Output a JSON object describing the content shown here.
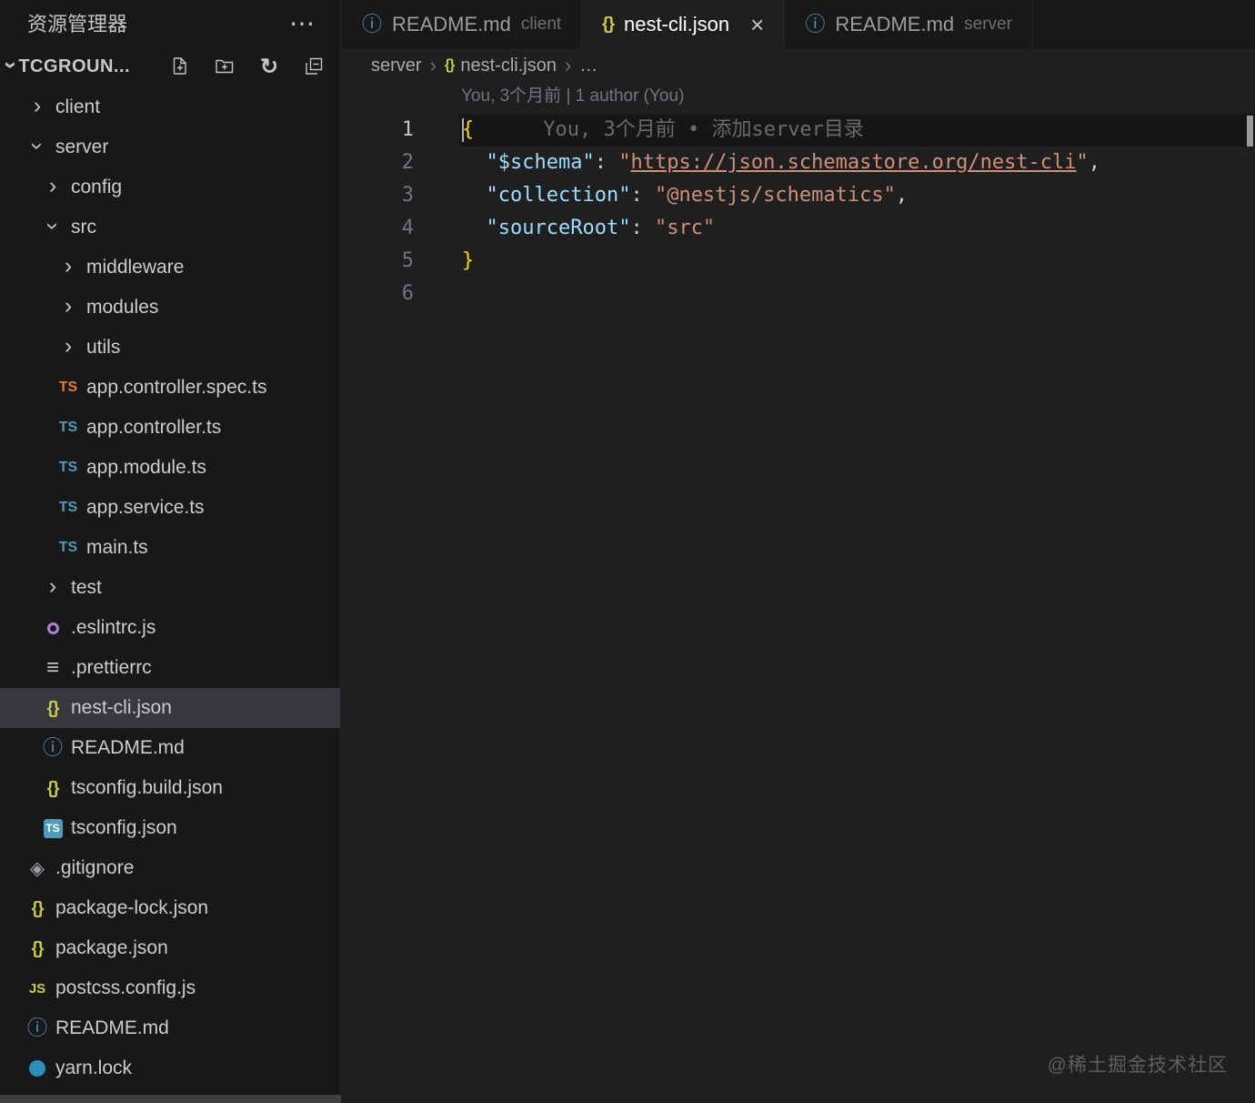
{
  "sidebar": {
    "title": "资源管理器",
    "more_actions": "⋯",
    "section": {
      "name": "TCGROUN...",
      "actions": [
        "new-file",
        "new-folder",
        "refresh",
        "collapse-all"
      ]
    },
    "tree": [
      {
        "label": "client",
        "kind": "folder",
        "expanded": false,
        "indent": 0
      },
      {
        "label": "server",
        "kind": "folder",
        "expanded": true,
        "indent": 0
      },
      {
        "label": "config",
        "kind": "folder",
        "expanded": false,
        "indent": 1
      },
      {
        "label": "src",
        "kind": "folder",
        "expanded": true,
        "indent": 1
      },
      {
        "label": "middleware",
        "kind": "folder",
        "expanded": false,
        "indent": 2
      },
      {
        "label": "modules",
        "kind": "folder",
        "expanded": false,
        "indent": 2
      },
      {
        "label": "utils",
        "kind": "folder",
        "expanded": false,
        "indent": 2
      },
      {
        "label": "app.controller.spec.ts",
        "kind": "file",
        "icon": "ts-orange",
        "indent": 2
      },
      {
        "label": "app.controller.ts",
        "kind": "file",
        "icon": "ts-blue",
        "indent": 2
      },
      {
        "label": "app.module.ts",
        "kind": "file",
        "icon": "ts-blue",
        "indent": 2
      },
      {
        "label": "app.service.ts",
        "kind": "file",
        "icon": "ts-blue",
        "indent": 2
      },
      {
        "label": "main.ts",
        "kind": "file",
        "icon": "ts-blue",
        "indent": 2
      },
      {
        "label": "test",
        "kind": "folder",
        "expanded": false,
        "indent": 1
      },
      {
        "label": ".eslintrc.js",
        "kind": "file",
        "icon": "eslint",
        "indent": 1
      },
      {
        "label": ".prettierrc",
        "kind": "file",
        "icon": "prettier",
        "indent": 1
      },
      {
        "label": "nest-cli.json",
        "kind": "file",
        "icon": "json",
        "indent": 1,
        "selected": true
      },
      {
        "label": "README.md",
        "kind": "file",
        "icon": "info",
        "indent": 1
      },
      {
        "label": "tsconfig.build.json",
        "kind": "file",
        "icon": "json",
        "indent": 1
      },
      {
        "label": "tsconfig.json",
        "kind": "file",
        "icon": "tsconfig",
        "indent": 1
      },
      {
        "label": ".gitignore",
        "kind": "file",
        "icon": "git",
        "indent": 0
      },
      {
        "label": "package-lock.json",
        "kind": "file",
        "icon": "json",
        "indent": 0
      },
      {
        "label": "package.json",
        "kind": "file",
        "icon": "json",
        "indent": 0
      },
      {
        "label": "postcss.config.js",
        "kind": "file",
        "icon": "js",
        "indent": 0
      },
      {
        "label": "README.md",
        "kind": "file",
        "icon": "info",
        "indent": 0
      },
      {
        "label": "yarn.lock",
        "kind": "file",
        "icon": "yarn",
        "indent": 0
      }
    ]
  },
  "tabs": [
    {
      "label": "README.md",
      "description": "client",
      "icon": "info",
      "active": false
    },
    {
      "label": "nest-cli.json",
      "description": "",
      "icon": "json",
      "active": true,
      "close": "×"
    },
    {
      "label": "README.md",
      "description": "server",
      "icon": "info",
      "active": false
    }
  ],
  "breadcrumb": {
    "items": [
      {
        "label": "server"
      },
      {
        "label": "nest-cli.json",
        "icon": "json"
      },
      {
        "label": "…"
      }
    ],
    "separator": "›"
  },
  "editor": {
    "blame_header": "You, 3个月前 | 1 author (You)",
    "lines": [
      {
        "num": "1",
        "highlight": true,
        "tokens": [
          {
            "t": "{",
            "c": "brace"
          }
        ],
        "blame": "You, 3个月前 • 添加server目录"
      },
      {
        "num": "2",
        "tokens": [
          {
            "t": "  ",
            "c": "punct"
          },
          {
            "t": "\"$schema\"",
            "c": "key"
          },
          {
            "t": ": ",
            "c": "punct"
          },
          {
            "t": "\"",
            "c": "str"
          },
          {
            "t": "https://json.schemastore.org/nest-cli",
            "c": "link"
          },
          {
            "t": "\"",
            "c": "str"
          },
          {
            "t": ",",
            "c": "punct"
          }
        ]
      },
      {
        "num": "3",
        "tokens": [
          {
            "t": "  ",
            "c": "punct"
          },
          {
            "t": "\"collection\"",
            "c": "key"
          },
          {
            "t": ": ",
            "c": "punct"
          },
          {
            "t": "\"@nestjs/schematics\"",
            "c": "str"
          },
          {
            "t": ",",
            "c": "punct"
          }
        ]
      },
      {
        "num": "4",
        "tokens": [
          {
            "t": "  ",
            "c": "punct"
          },
          {
            "t": "\"sourceRoot\"",
            "c": "key"
          },
          {
            "t": ": ",
            "c": "punct"
          },
          {
            "t": "\"src\"",
            "c": "str"
          }
        ]
      },
      {
        "num": "5",
        "tokens": [
          {
            "t": "}",
            "c": "brace"
          }
        ]
      },
      {
        "num": "6",
        "tokens": []
      }
    ]
  },
  "watermark": "@稀土掘金技术社区",
  "colors": {
    "sidebar_bg": "#181818",
    "editor_bg": "#1f1f1f",
    "selection_bg": "#37373d",
    "json_key": "#9cdcfe",
    "string": "#ce9178",
    "brace": "#ffd700",
    "line_number": "#6e7681",
    "blame_text": "#6a6a6a",
    "ts_blue": "#519aba",
    "ts_orange": "#e37933",
    "json_yellow": "#cbcb41",
    "eslint_purple": "#b180d7",
    "yarn_blue": "#2b90b8"
  }
}
